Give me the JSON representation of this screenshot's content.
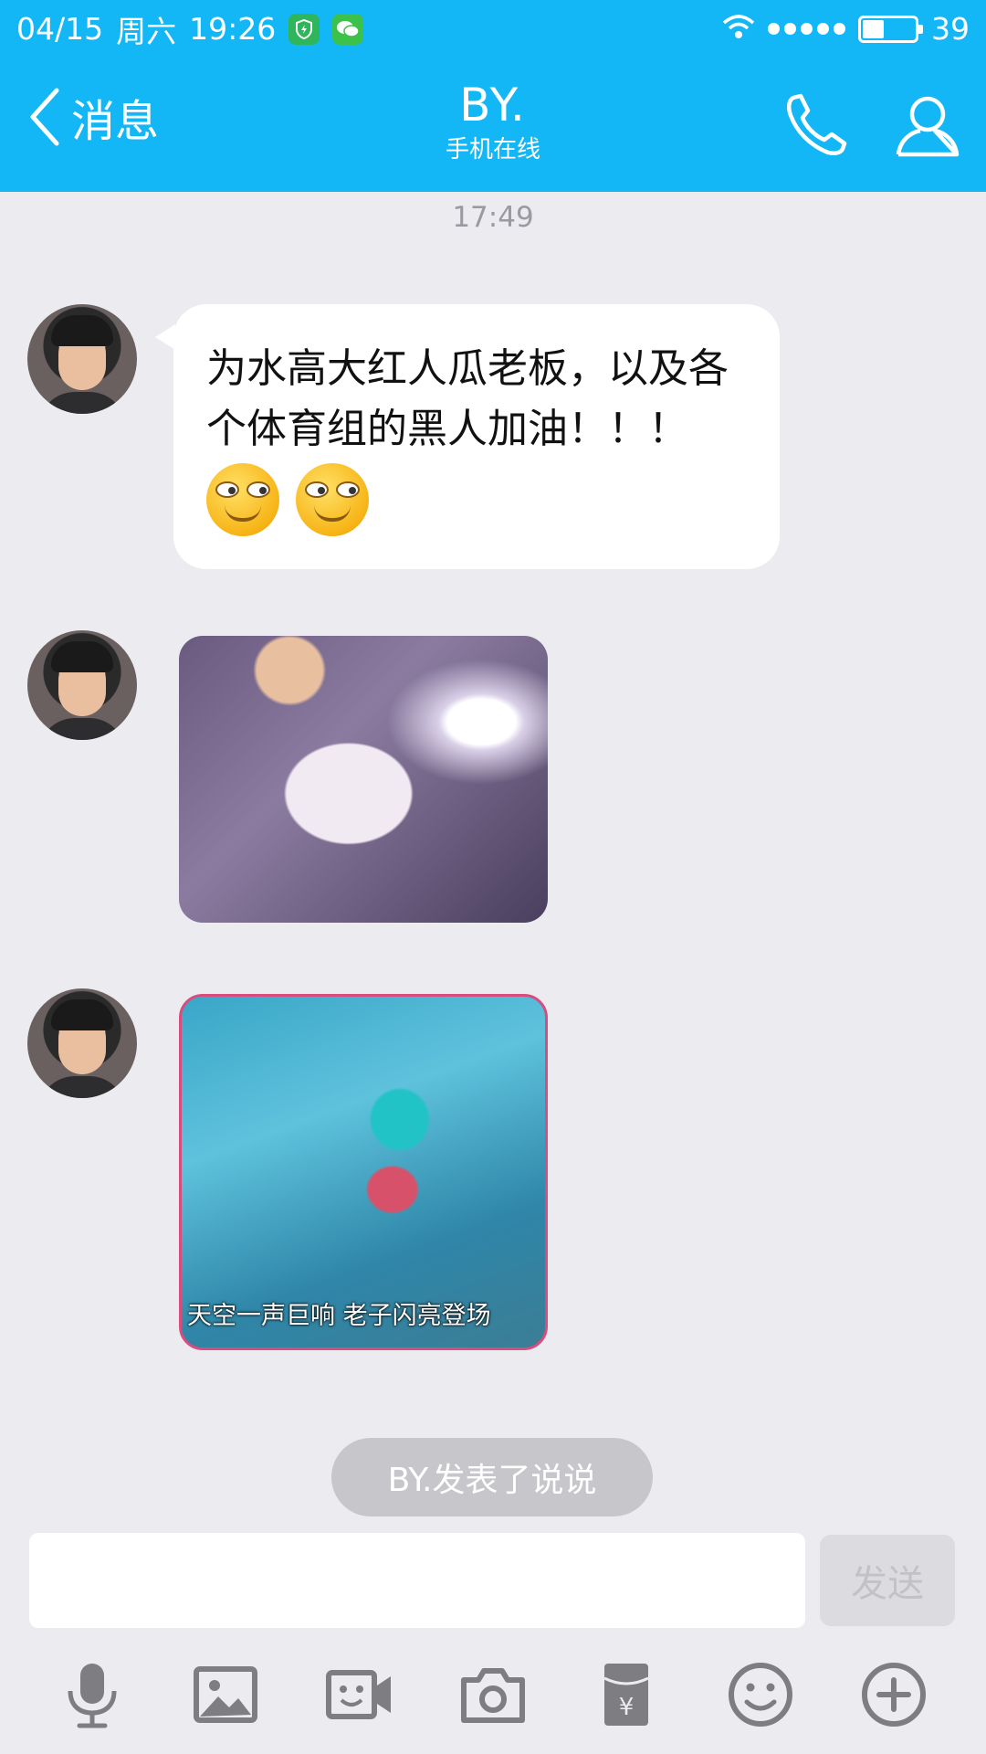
{
  "status_bar": {
    "date": "04/15",
    "weekday": "周六",
    "time": "19:26",
    "battery_level": "39",
    "battery_fraction": 0.39
  },
  "nav": {
    "back_label": "消息",
    "title": "BY.",
    "subtitle": "手机在线"
  },
  "chat": {
    "timestamp": "17:49",
    "messages": [
      {
        "type": "text",
        "text": "为水高大红人瓜老板，以及各个体育组的黑人加油！！！"
      },
      {
        "type": "image"
      },
      {
        "type": "image",
        "caption": "天空一声巨响 老子闪亮登场"
      }
    ],
    "moment_notice": "BY.发表了说说"
  },
  "input": {
    "value": "",
    "placeholder": "",
    "send_label": "发送"
  },
  "toolbar": {
    "icons": [
      "microphone-icon",
      "image-icon",
      "video-call-icon",
      "camera-icon",
      "red-packet-icon",
      "emoji-icon",
      "plus-icon"
    ]
  },
  "colors": {
    "header": "#13b7f5",
    "background": "#ebebf0",
    "bubble": "#ffffff",
    "icon": "#7d7d82"
  }
}
